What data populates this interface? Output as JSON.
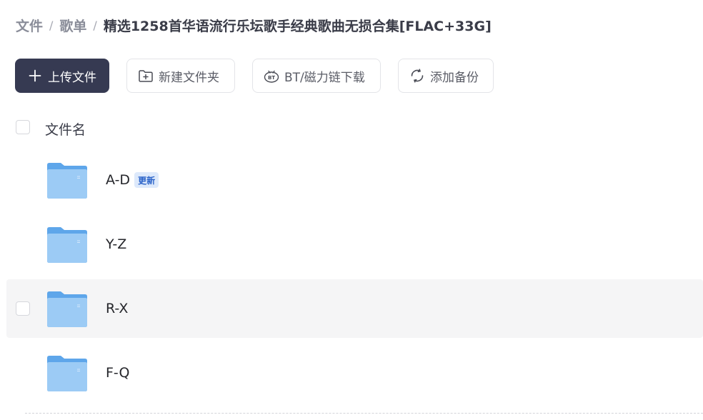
{
  "breadcrumb": {
    "items": [
      "文件",
      "歌单"
    ],
    "separator": "/",
    "current": "精选1258首华语流行乐坛歌手经典歌曲无损合集[FLAC+33G]"
  },
  "toolbar": {
    "upload_label": "上传文件",
    "new_folder_label": "新建文件夹",
    "bt_label": "BT/磁力链下载",
    "backup_label": "添加备份"
  },
  "list": {
    "header": "文件名",
    "rows": [
      {
        "name": "A-D",
        "badge": "更新",
        "icon": "folder-icon",
        "state": "normal"
      },
      {
        "name": "Y-Z",
        "badge": "",
        "icon": "folder-icon",
        "state": "normal"
      },
      {
        "name": "R-X",
        "badge": "",
        "icon": "folder-icon",
        "state": "hover"
      },
      {
        "name": "F-Q",
        "badge": "",
        "icon": "folder-icon",
        "state": "normal"
      }
    ]
  },
  "colors": {
    "primary_button": "#363a52",
    "badge_bg": "#dde9fb",
    "badge_text": "#2a63c9",
    "folder": "#8cc3f3",
    "hover_row": "#f5f5f6"
  }
}
